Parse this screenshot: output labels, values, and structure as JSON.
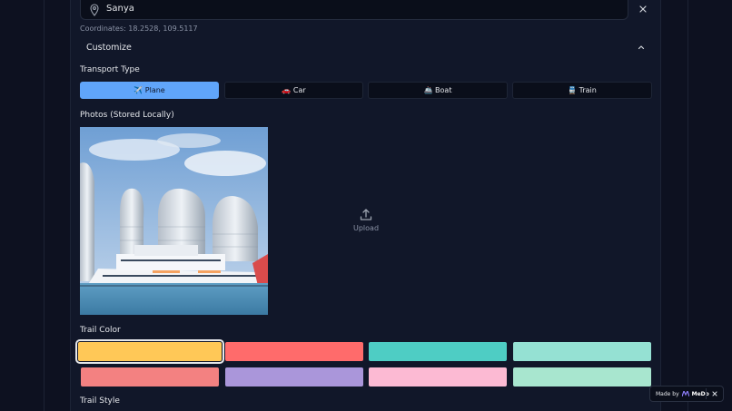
{
  "location": {
    "value": "Sanya",
    "coordinates_text": "Coordinates: 18.2528, 109.5117"
  },
  "customize": {
    "label": "Customize"
  },
  "transport": {
    "label": "Transport Type",
    "options": [
      {
        "label": "✈️ Plane",
        "active": true
      },
      {
        "label": "🚗 Car",
        "active": false
      },
      {
        "label": "🚢 Boat",
        "active": false
      },
      {
        "label": "🚆 Train",
        "active": false
      }
    ]
  },
  "photos": {
    "label": "Photos (Stored Locally)",
    "upload_label": "Upload"
  },
  "trail_color": {
    "label": "Trail Color",
    "swatches": [
      "#ffc857",
      "#ff6b6b",
      "#4ecdc4",
      "#95e1d3",
      "#f38181",
      "#aa96da",
      "#fcbad3",
      "#a8e6cf"
    ],
    "selected_index": 0
  },
  "trail_style": {
    "label": "Trail Style"
  },
  "made_by": {
    "prefix": "Made by",
    "brand": "MeDo"
  }
}
